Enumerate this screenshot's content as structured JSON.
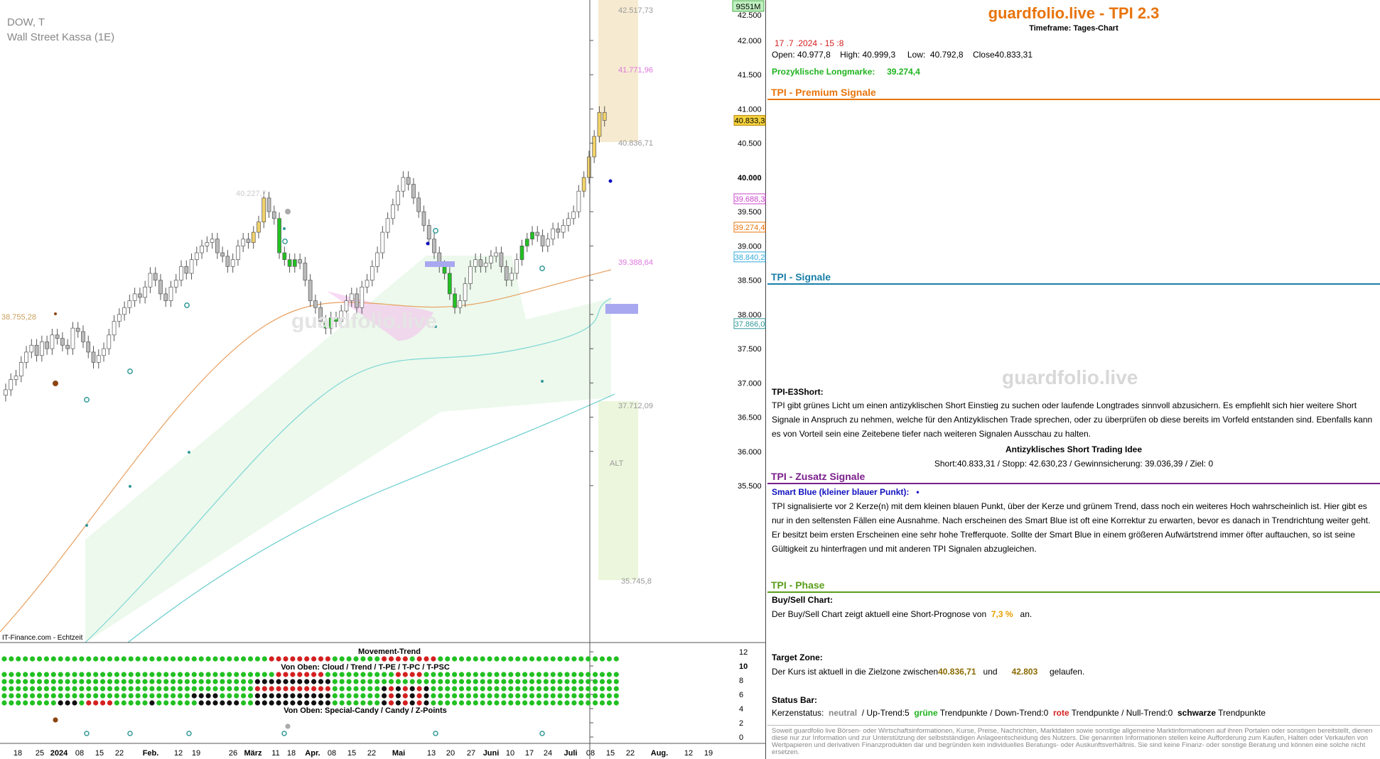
{
  "chart": {
    "symbol": "DOW, T",
    "name": "Wall Street Kassa (1E)",
    "badge": "9S51M",
    "source_label": "IT-Finance.com - Echtzeit",
    "watermark": "guardfolio.live",
    "alt_label": "ALT",
    "level_labels": {
      "top": "42.517,73",
      "mid_pink": "41.771,96",
      "target": "40.836,71",
      "pink_low": "39.388,64",
      "green_low": "37.712,09",
      "bottom": "35.745,8",
      "left_level": "38.755,28",
      "old_high": "40.227,7"
    },
    "axis_badges": [
      {
        "label": "40.833,3",
        "value": 40833,
        "bg": "#f5d23c",
        "border": "#b8860b",
        "text": "#000000"
      },
      {
        "label": "39.688,3",
        "value": 39688,
        "bg": "#ffffff",
        "border": "#cc44cc",
        "text": "#cc44cc"
      },
      {
        "label": "39.274,4",
        "value": 39274,
        "bg": "#ffffff",
        "border": "#e8740c",
        "text": "#e8740c"
      },
      {
        "label": "38.840,2",
        "value": 38840,
        "bg": "#ffffff",
        "border": "#33aadd",
        "text": "#33aadd"
      },
      {
        "label": "37.866,0",
        "value": 37866,
        "bg": "#ffffff",
        "border": "#339999",
        "text": "#339999"
      }
    ],
    "indicator": {
      "movement_trend": "Movement-Trend",
      "von_oben_1": "Von Oben: Cloud / Trend / T-PE / T-PC / T-PSC",
      "von_oben_2": "Von Oben: Special-Candy / Candy / Z-Points",
      "scale": [
        "12",
        "10",
        "8",
        "6",
        "4",
        "2",
        "0"
      ]
    }
  },
  "chart_data": {
    "type": "candlestick",
    "yaxis": {
      "ticks": [
        42000,
        41500,
        41000,
        40500,
        40000,
        39500,
        39000,
        38500,
        38000,
        37500,
        37000,
        36500,
        36000,
        35500
      ],
      "tick_labels": [
        "42.000",
        "41.500",
        "41.000",
        "40.500",
        "40.000",
        "39.500",
        "39.000",
        "38.500",
        "38.000",
        "37.500",
        "37.000",
        "36.500",
        "36.000",
        "35.500"
      ]
    },
    "xaxis": {
      "tick_labels": [
        "18",
        "25",
        "2024",
        "08",
        "15",
        "22",
        "Feb.",
        "12",
        "19",
        "26",
        "März",
        "11",
        "18",
        "Apr.",
        "08",
        "15",
        "22",
        "Mai",
        "13",
        "20",
        "27",
        "Juni",
        "10",
        "17",
        "24",
        "Juli",
        "08",
        "15",
        "22",
        "Aug.",
        "12",
        "19"
      ]
    },
    "ohlc": {
      "date": "17 .7 .2024 - 15 :8",
      "open": "40.977,8",
      "high": "40.999,3",
      "low": "40.792,8",
      "close": "40.833,31"
    },
    "closes": [
      36900,
      37050,
      37100,
      37300,
      37450,
      37550,
      37400,
      37600,
      37500,
      37700,
      37650,
      37550,
      37500,
      37800,
      37750,
      37600,
      37450,
      37300,
      37400,
      37500,
      37700,
      37900,
      38000,
      38100,
      38200,
      38300,
      38250,
      38400,
      38600,
      38500,
      38300,
      38200,
      38400,
      38500,
      38700,
      38600,
      38800,
      38900,
      39000,
      39050,
      39100,
      38900,
      38850,
      38700,
      38800,
      39000,
      39100,
      39050,
      39200,
      39350,
      39700,
      39500,
      39400,
      38900,
      38800,
      38700,
      38800,
      38750,
      38500,
      38200,
      38100,
      37900,
      37800,
      37950,
      37900,
      38050,
      38200,
      38300,
      38100,
      38400,
      38500,
      38700,
      38900,
      39200,
      39400,
      39600,
      39800,
      40000,
      39900,
      39700,
      39500,
      39300,
      39100,
      38900,
      38700,
      38600,
      38300,
      38100,
      38200,
      38450,
      38700,
      38800,
      38700,
      38750,
      38850,
      38900,
      38700,
      38500,
      38600,
      38800,
      39000,
      39100,
      39200,
      39150,
      39000,
      39100,
      39250,
      39200,
      39300,
      39400,
      39500,
      39800,
      40000,
      40300,
      40600,
      40950,
      40833
    ]
  },
  "panel": {
    "title": "guardfolio.live - TPI 2.3",
    "timeframe": "Timeframe: Tages-Chart",
    "date_line": "17 .7 .2024 - 15 :8",
    "open_label": "Open:",
    "open": "40.977,8",
    "high_label": "High:",
    "high": "40.999,3",
    "low_label": "Low:",
    "low": "40.792,8",
    "close_label": "Close",
    "close": "40.833,31",
    "longmark_label": "Prozyklische Longmarke:",
    "longmark_value": "39.274,4",
    "sec_premium": "TPI - Premium Signale",
    "sec_signale": "TPI - Signale",
    "watermark": "guardfolio.live",
    "e3_title": "TPI-E3Short:",
    "e3_text": "TPI gibt grünes Licht um einen antizyklischen Short Einstieg zu suchen oder laufende Longtrades sinnvoll abzusichern. Es empfiehlt sich hier weitere Short Signale in Anspruch zu nehmen, welche für den Antizyklischen Trade sprechen, oder zu überprüfen ob diese bereits im Vorfeld entstanden sind. Ebenfalls kann es von Vorteil sein eine Zeitebene tiefer nach weiteren Signalen Ausschau zu halten.",
    "idea_title": "Antizyklisches Short Trading Idee",
    "idea_line": "Short:40.833,31 / Stopp: 42.630,23 / Gewinnsicherung: 39.036,39 / Ziel: 0",
    "sec_zusatz": "TPI - Zusatz Signale",
    "smart_title": "Smart Blue (kleiner blauer Punkt):",
    "smart_dot": "•",
    "smart_text": "TPI signalisierte vor 2 Kerze(n) mit dem kleinen blauen Punkt, über der Kerze und grünem Trend, dass noch ein weiteres Hoch wahrscheinlich ist. Hier gibt es nur in den seltensten Fällen eine Ausnahme. Nach erscheinen des Smart Blue ist oft eine Korrektur zu erwarten, bevor es danach in Trendrichtung weiter geht. Er besitzt beim ersten Erscheinen eine sehr hohe Trefferquote. Sollte der Smart Blue in einem größeren Aufwärtstrend immer öfter auftauchen, so ist seine Gültigkeit zu hinterfragen und mit anderen TPI Signalen abzugleichen.",
    "sec_phase": "TPI - Phase",
    "bs_title": "Buy/Sell Chart:",
    "bs_text_a": "Der Buy/Sell Chart zeigt aktuell eine Short-Prognose von",
    "bs_pct": "7,3 %",
    "bs_text_b": "an.",
    "tz_title": "Target Zone:",
    "tz_text_a": "Der Kurs ist aktuell in die Zielzone zwischen",
    "tz_low": "40.836,71",
    "tz_und": "und",
    "tz_high": "42.803",
    "tz_text_b": "gelaufen.",
    "sb_title": "Status Bar:",
    "sb_kern": "Kerzenstatus:",
    "sb_neutral": "neutral",
    "sb_up": "/ Up-Trend:5",
    "sb_gruene": "grüne",
    "sb_tp1": "Trendpunkte / Down-Trend:0",
    "sb_rote": "rote",
    "sb_tp2": "Trendpunkte / Null-Trend:0",
    "sb_schwarze": "schwarze",
    "sb_tp3": "Trendpunkte",
    "footer": "Soweit guardfolio live Börsen- oder Wirtschaftsinformationen, Kurse, Preise, Nachrichten, Marktdaten sowie sonstige allgemeine Marktinformationen auf ihren Portalen oder sonstigen bereitstellt, dienen diese nur zur Information und zur Unterstützung der selbstständigen Anlageentscheidung des Nutzers. Die genannten Informationen stellen keine Aufforderung zum Kaufen, Halten oder Verkaufen von Wertpapieren und derivativen Finanzprodukten dar und begründen kein individuelles Beratungs- oder Auskunftsverhältnis. Sie sind keine Finanz- oder sonstige Beratung und können eine solche nicht ersetzen."
  },
  "colors": {
    "brand": "#e8740c",
    "premium_line": "#e8740c",
    "signale_line": "#1a7fa8",
    "signale_text": "#1a7fa8",
    "zusatz_line": "#7a1f8c",
    "zusatz_text": "#7a1f8c",
    "phase_line": "#5a9e1a",
    "phase_text": "#5a9e1a",
    "green": "#1db31d",
    "red": "#d42020",
    "blue": "#1010c0"
  }
}
